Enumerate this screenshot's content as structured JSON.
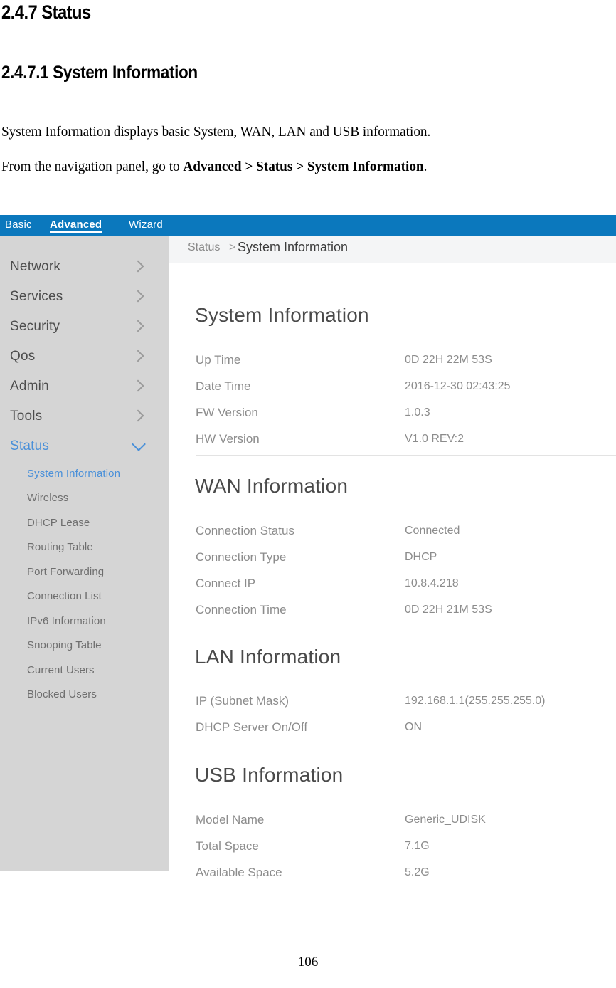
{
  "document": {
    "heading1": "2.4.7 Status",
    "heading2": "2.4.7.1 System Information",
    "paragraph1": "System Information displays basic System, WAN, LAN and USB information.",
    "paragraph2_prefix": "From the navigation panel, go to ",
    "paragraph2_bold": "Advanced > Status > System Information",
    "paragraph2_suffix": ".",
    "page_number": "106"
  },
  "screenshot": {
    "topbar": {
      "items": [
        {
          "label": "Basic",
          "active": false
        },
        {
          "label": "Advanced",
          "active": true
        },
        {
          "label": "Wizard",
          "active": false
        }
      ]
    },
    "sidebar": {
      "items": [
        {
          "label": "Network",
          "icon": "chevron-right-icon",
          "active": false
        },
        {
          "label": "Services",
          "icon": "chevron-right-icon",
          "active": false
        },
        {
          "label": "Security",
          "icon": "chevron-right-icon",
          "active": false
        },
        {
          "label": "Qos",
          "icon": "chevron-right-icon",
          "active": false
        },
        {
          "label": "Admin",
          "icon": "chevron-right-icon",
          "active": false
        },
        {
          "label": "Tools",
          "icon": "chevron-right-icon",
          "active": false
        },
        {
          "label": "Status",
          "icon": "chevron-down-icon",
          "active": true
        }
      ],
      "submenu": [
        {
          "label": "System Information",
          "active": true
        },
        {
          "label": "Wireless",
          "active": false
        },
        {
          "label": "DHCP Lease",
          "active": false
        },
        {
          "label": "Routing Table",
          "active": false
        },
        {
          "label": "Port Forwarding",
          "active": false
        },
        {
          "label": "Connection List",
          "active": false
        },
        {
          "label": "IPv6 Information",
          "active": false
        },
        {
          "label": "Snooping Table",
          "active": false
        },
        {
          "label": "Current Users",
          "active": false
        },
        {
          "label": "Blocked Users",
          "active": false
        }
      ]
    },
    "breadcrumb": {
      "parent": "Status",
      "separator": ">",
      "current": "System Information"
    },
    "sections": [
      {
        "title": "System Information",
        "rows": [
          {
            "label": "Up Time",
            "value": "0D 22H 22M 53S"
          },
          {
            "label": "Date Time",
            "value": "2016-12-30 02:43:25"
          },
          {
            "label": "FW Version",
            "value": "1.0.3"
          },
          {
            "label": "HW Version",
            "value": "V1.0 REV:2"
          }
        ]
      },
      {
        "title": "WAN Information",
        "rows": [
          {
            "label": "Connection Status",
            "value": "Connected"
          },
          {
            "label": "Connection Type",
            "value": "DHCP"
          },
          {
            "label": "Connect IP",
            "value": "10.8.4.218"
          },
          {
            "label": "Connection Time",
            "value": "0D 22H 21M 53S"
          }
        ]
      },
      {
        "title": "LAN Information",
        "rows": [
          {
            "label": "IP (Subnet Mask)",
            "value": "192.168.1.1(255.255.255.0)"
          },
          {
            "label": "DHCP Server On/Off",
            "value": "ON"
          }
        ]
      },
      {
        "title": "USB Information",
        "rows": [
          {
            "label": "Model Name",
            "value": "Generic_UDISK"
          },
          {
            "label": "Total Space",
            "value": "7.1G"
          },
          {
            "label": "Available Space",
            "value": "5.2G"
          }
        ]
      }
    ],
    "colors": {
      "topbar_blue": "#0b78bd",
      "accent_blue": "#4a90d9",
      "sidebar_gray": "#d5d5d5",
      "breadcrumb_gray": "#f4f5f6",
      "text_gray": "#8c8c8c"
    }
  }
}
